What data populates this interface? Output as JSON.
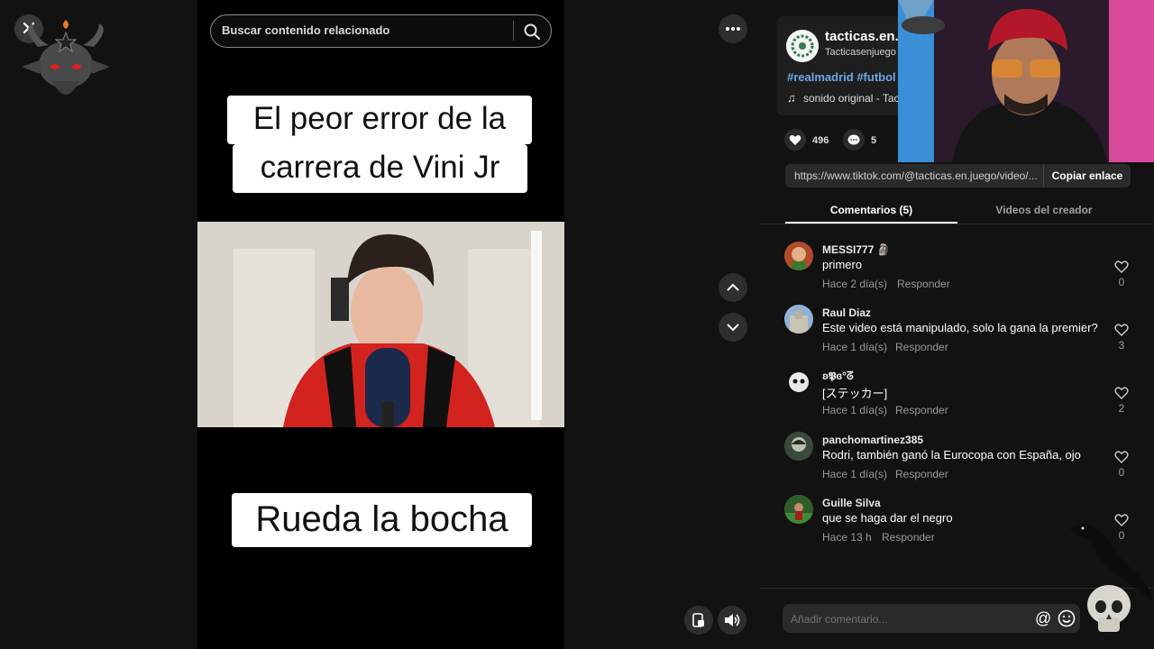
{
  "player": {
    "search_placeholder": "Buscar contenido relacionado",
    "caption_top_line1": "El peor error de la",
    "caption_top_line2": "carrera de Vini Jr",
    "caption_bottom": "Rueda la bocha"
  },
  "creator": {
    "name": "tacticas.en.",
    "handle": "Tacticasenjuego",
    "hashtags": "#realmadrid #futbol",
    "sound": "sonido original - Tac"
  },
  "stats": {
    "likes": "496",
    "comments": "5"
  },
  "link": {
    "url": "https://www.tiktok.com/@tacticas.en.juego/video/...",
    "copy_label": "Copiar enlace"
  },
  "tabs": [
    {
      "label": "Comentarios (5)"
    },
    {
      "label": "Videos del creador"
    }
  ],
  "comments": [
    {
      "user": "MESSI777 🗿",
      "text": "primero",
      "time": "Hace 2 día(s)",
      "reply": "Responder",
      "likes": "0"
    },
    {
      "user": "Raul Diaz",
      "text": "Este video está manipulado, solo la gana la premier?",
      "time": "Hace 1 día(s)",
      "reply": "Responder",
      "likes": "3"
    },
    {
      "user": "ʚ𝕻ɞ°ᘔ",
      "text": "[ステッカー]",
      "time": "Hace 1 día(s)",
      "reply": "Responder",
      "likes": "2"
    },
    {
      "user": "panchomartinez385",
      "text": "Rodri, también ganó la Eurocopa con España, ojo",
      "time": "Hace 1 día(s)",
      "reply": "Responder",
      "likes": "0"
    },
    {
      "user": "Guille Silva",
      "text": "que se haga dar el negro",
      "time": "Hace 13 h",
      "reply": "Responder",
      "likes": "0"
    }
  ],
  "add_comment": {
    "placeholder": "Añadir comentario...",
    "at": "@"
  },
  "icons": {
    "close": "close-icon",
    "more": "more-icon",
    "nav_up": "chevron-up-icon",
    "nav_down": "chevron-down-icon",
    "volume": "volume-icon",
    "pip": "pip-icon"
  },
  "colors": {
    "background": "#121212",
    "hashtag": "#6ea7e8",
    "muted": "#9a9a9a"
  }
}
